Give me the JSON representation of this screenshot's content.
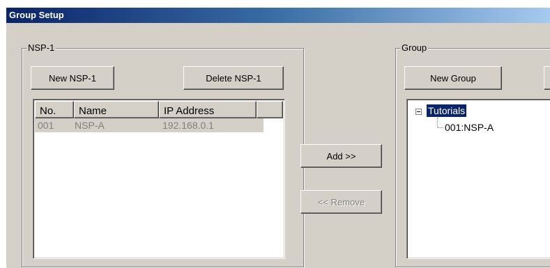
{
  "window": {
    "title": "Group Setup"
  },
  "nsp_panel": {
    "legend": "NSP-1",
    "new_button": "New NSP-1",
    "delete_button": "Delete NSP-1",
    "columns": [
      "No.",
      "Name",
      "IP Address"
    ],
    "rows": [
      {
        "no": "001",
        "name": "NSP-A",
        "ip": "192.168.0.1"
      }
    ]
  },
  "middle": {
    "add_button": "Add >>",
    "remove_button": "<< Remove"
  },
  "group_panel": {
    "legend": "Group",
    "new_button": "New Group",
    "tree": {
      "root": "Tutorials",
      "children": [
        "001:NSP-A"
      ]
    }
  }
}
